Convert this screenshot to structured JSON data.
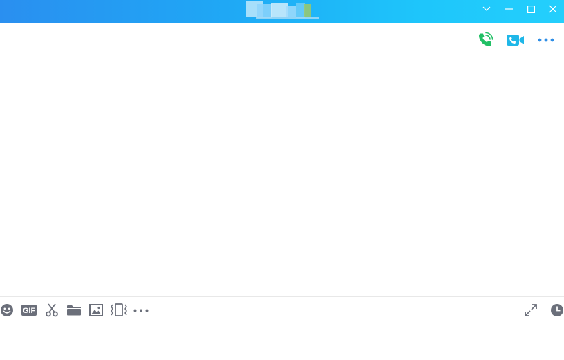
{
  "window": {
    "title_bar_gradient_start": "#2a8ff0",
    "title_bar_gradient_end": "#24cffc",
    "controls": [
      {
        "name": "dropdown",
        "icon": "chevron-down-icon"
      },
      {
        "name": "minimize",
        "icon": "minimize-icon"
      },
      {
        "name": "maximize",
        "icon": "maximize-icon"
      },
      {
        "name": "close",
        "icon": "close-icon"
      }
    ]
  },
  "header": {
    "actions": [
      {
        "name": "voice-call",
        "icon": "phone-call-icon",
        "color": "#21c065"
      },
      {
        "name": "video-call",
        "icon": "video-camera-icon",
        "color": "#1fb7e8"
      },
      {
        "name": "more",
        "icon": "more-dots-icon",
        "color": "#2e8ee6"
      }
    ]
  },
  "toolbar": {
    "icon_color": "#6b6f7a",
    "left_tools": [
      {
        "name": "emoji",
        "icon": "emoji-icon"
      },
      {
        "name": "gif",
        "icon": "gif-icon",
        "label": "GIF"
      },
      {
        "name": "screenshot",
        "icon": "scissors-icon"
      },
      {
        "name": "file",
        "icon": "folder-icon"
      },
      {
        "name": "image",
        "icon": "image-icon"
      },
      {
        "name": "shake",
        "icon": "shake-window-icon"
      },
      {
        "name": "more",
        "icon": "more-dots-icon"
      }
    ],
    "right_tools": [
      {
        "name": "expand",
        "icon": "expand-icon"
      },
      {
        "name": "history",
        "icon": "clock-icon"
      }
    ]
  },
  "input": {
    "value": "",
    "placeholder": ""
  }
}
